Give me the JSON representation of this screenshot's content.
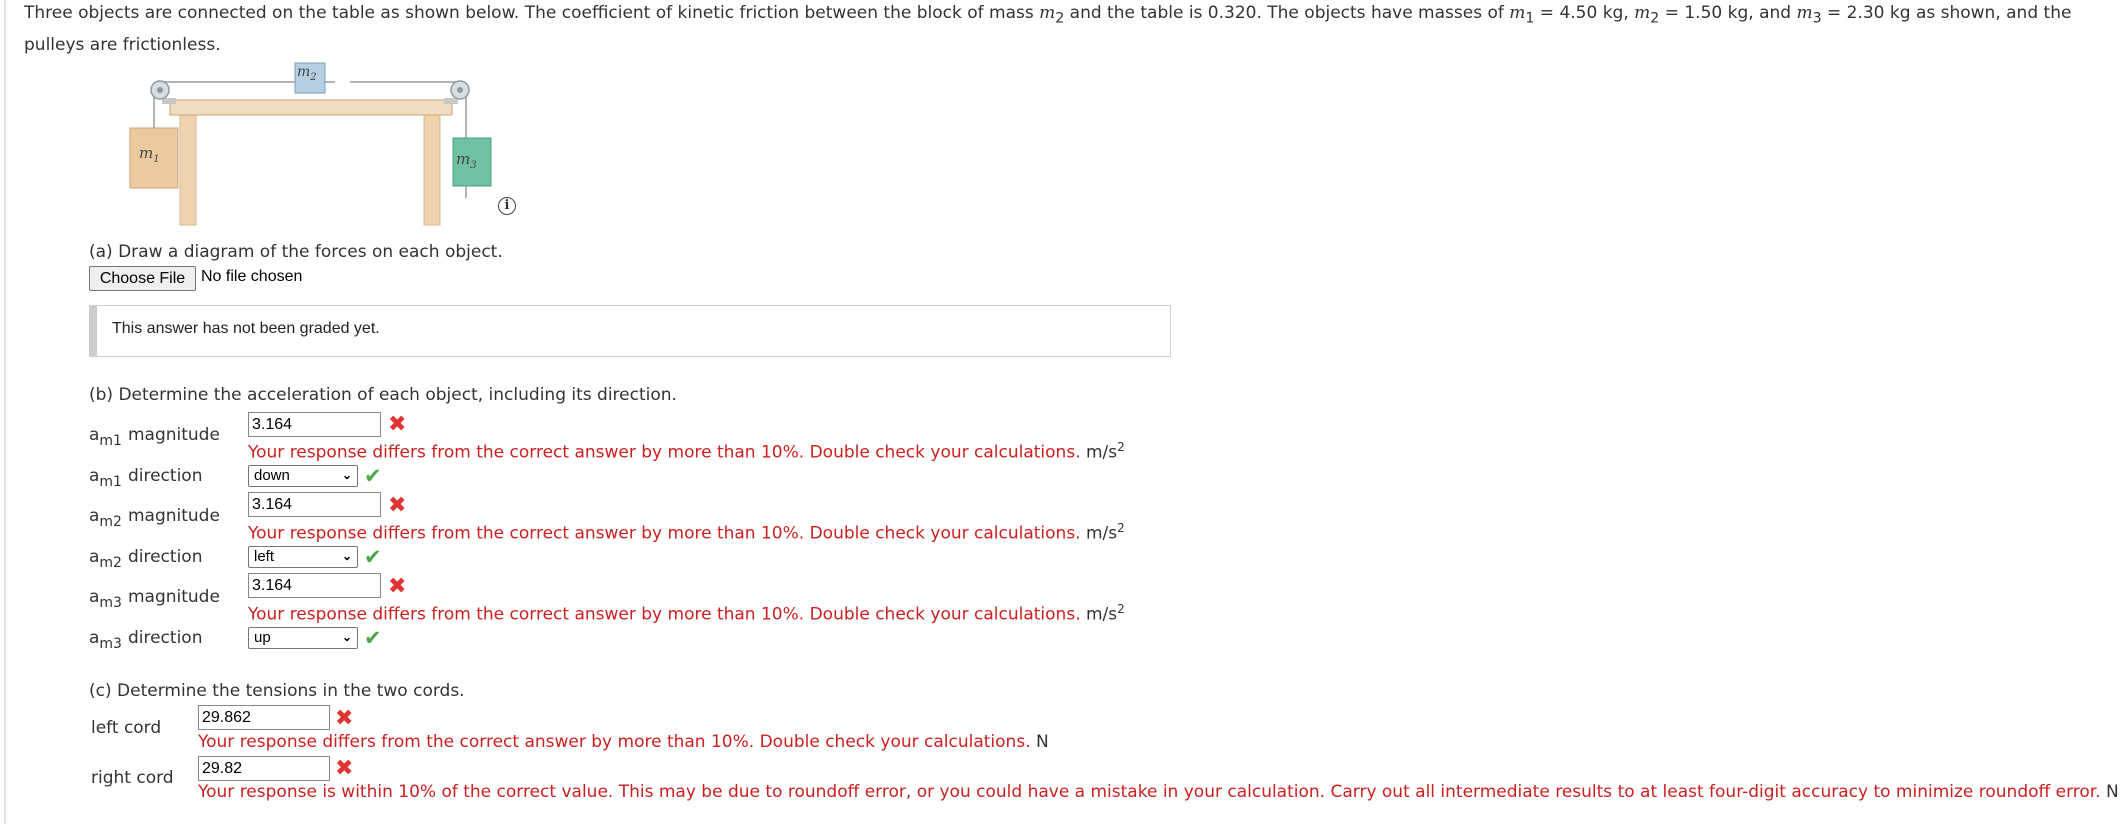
{
  "problem": {
    "intro": "Three objects are connected on the table as shown below. The coefficient of kinetic friction between the block of mass ",
    "m2_sym": "m",
    "m2_sub": "2",
    "mid": " and the table is 0.320. The objects have masses of ",
    "m1_sym": "m",
    "m1_sub": "1",
    "m1_val": " = 4.50 kg, ",
    "m2b_sym": "m",
    "m2b_sub": "2",
    "m2_val": " = 1.50 kg, and ",
    "m3_sym": "m",
    "m3_sub": "3",
    "m3_val": " = 2.30 kg as shown, and the pulleys are frictionless."
  },
  "figure": {
    "m1_label": "m",
    "m1_sub": "1",
    "m2_label": "m",
    "m2_sub": "2",
    "m3_label": "m",
    "m3_sub": "3",
    "info_icon": "info-icon",
    "info_text": "i"
  },
  "part_a": {
    "prompt": "(a) Draw a diagram of the forces on each object.",
    "choose_file": "Choose File",
    "no_file": "No file chosen",
    "grade_status": "This answer has not been graded yet."
  },
  "part_b": {
    "prompt": "(b) Determine the acceleration of each object, including its direction.",
    "rows": [
      {
        "symbol": "a",
        "sub": "m1",
        "label": "magnitude",
        "value": "3.164",
        "feedback": "Your response differs from the correct answer by more than 10%. Double check your calculations.",
        "unit": "m/s",
        "unit_exp": "2"
      },
      {
        "symbol": "a",
        "sub": "m1",
        "label": "direction",
        "selected": "down"
      },
      {
        "symbol": "a",
        "sub": "m2",
        "label": "magnitude",
        "value": "3.164",
        "feedback": "Your response differs from the correct answer by more than 10%. Double check your calculations.",
        "unit": "m/s",
        "unit_exp": "2"
      },
      {
        "symbol": "a",
        "sub": "m2",
        "label": "direction",
        "selected": "left"
      },
      {
        "symbol": "a",
        "sub": "m3",
        "label": "magnitude",
        "value": "3.164",
        "feedback": "Your response differs from the correct answer by more than 10%. Double check your calculations.",
        "unit": "m/s",
        "unit_exp": "2"
      },
      {
        "symbol": "a",
        "sub": "m3",
        "label": "direction",
        "selected": "up"
      }
    ]
  },
  "part_c": {
    "prompt": "(c) Determine the tensions in the two cords.",
    "left_label": "left cord",
    "left_value": "29.862",
    "left_feedback": "Your response differs from the correct answer by more than 10%. Double check your calculations.",
    "left_unit": "N",
    "right_label": "right cord",
    "right_value": "29.82",
    "right_feedback": "Your response is within 10% of the correct value. This may be due to roundoff error, or you could have a mistake in your calculation. Carry out all intermediate results to at least four-digit accuracy to minimize roundoff error.",
    "right_unit": "N"
  },
  "icons": {
    "incorrect": "✖",
    "correct": "✔",
    "dropdown": "⌄"
  },
  "colors": {
    "error_text": "#cc1f1f",
    "incorrect_mark": "#e03434",
    "correct_mark": "#4aa84a",
    "block_m1": "#ecc99e",
    "block_m2": "#b5cfe4",
    "block_m3": "#6fc2a0"
  }
}
